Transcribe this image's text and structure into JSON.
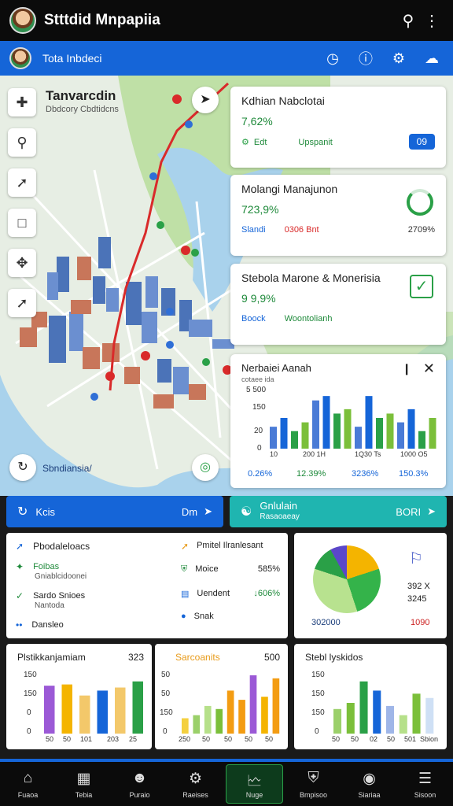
{
  "app": {
    "title": "Stttdid Mnpapiia",
    "subtitle": "Tota Inbdeci"
  },
  "map": {
    "title": "Tanvarcdin",
    "subtitle": "Dbdcory Cbdtidcns",
    "location_label": "Sbndiansia/"
  },
  "cards": [
    {
      "title": "Kdhian Nabclotai",
      "value": "7,62%",
      "row_left": "Edt",
      "row_right": "Upspanit",
      "badge": "09"
    },
    {
      "title": "Molangi Manajunon",
      "value": "723,9%",
      "row_a": "Slandi",
      "row_b": "0306 Bnt",
      "row_c": "2709%"
    },
    {
      "title": "Stebola Marone & Monerisia",
      "value": "9 9,9%",
      "row_a": "Boock",
      "row_b": "Woontolianh"
    }
  ],
  "popup_chart": {
    "title": "Nerbaiei Aanah",
    "subtitle": "cotaee ida",
    "yticks": [
      "5 500",
      "150",
      "20",
      "0"
    ],
    "x": [
      "10",
      "200  1H",
      "1Q30 Ts",
      "1000 O5"
    ],
    "footer": [
      "0.26%",
      "12.39%",
      "3236%",
      "150.3%"
    ]
  },
  "actions": {
    "left_label": "Kcis",
    "left_btn": "Dm",
    "right_label": "Gnlulain",
    "right_sub": "Rasaoaeay",
    "right_btn": "BORI"
  },
  "mid": {
    "h1": "Pbodaleloacs",
    "i1": "Foibas",
    "i1s": "Gniablcidoonei",
    "i2": "Sardo Snioes",
    "i2s": "Nantoda",
    "i3": "Dansleo",
    "h2": "Pmitel Ilranlesant",
    "j1": "Moice",
    "j1v": "585%",
    "j2": "Uendent",
    "j2v": "↓606%",
    "j3": "Snak",
    "r1": "392 X",
    "r2": "3245",
    "pie_left": "302000",
    "pie_right": "1090"
  },
  "charts": [
    {
      "title": "Plstikkanjamiam",
      "val": "323",
      "yticks": [
        "150",
        "150",
        "0",
        "0"
      ],
      "x": [
        "50",
        "50",
        "101",
        "203",
        "25"
      ],
      "chart_data": {
        "type": "bar",
        "values": [
          78,
          80,
          62,
          70,
          75,
          85
        ]
      }
    },
    {
      "title": "Sarcoanits",
      "val": "500",
      "yticks": [
        "50",
        "50",
        "150",
        "0"
      ],
      "x": [
        "250",
        "50",
        "50",
        "50",
        "50"
      ],
      "chart_data": {
        "type": "bar",
        "values": [
          25,
          30,
          45,
          40,
          70,
          55,
          95,
          60,
          90
        ]
      }
    },
    {
      "title": "Stebl lyskidos",
      "val": "",
      "yticks": [
        "150",
        "150",
        "150",
        "0"
      ],
      "x": [
        "50",
        "50",
        "02",
        "50",
        "501",
        "Sbion"
      ],
      "chart_data": {
        "type": "bar",
        "values": [
          40,
          50,
          85,
          70,
          45,
          30,
          65,
          58
        ]
      }
    }
  ],
  "nav": [
    "Fuaoa",
    "Tebia",
    "Puraio",
    "Raeises",
    "Nuge",
    "Bmpisoo",
    "Siariaa",
    "Sisoon"
  ],
  "colors": {
    "blue": "#1565d8",
    "green": "#2aa047",
    "teal": "#1fb5b0"
  }
}
